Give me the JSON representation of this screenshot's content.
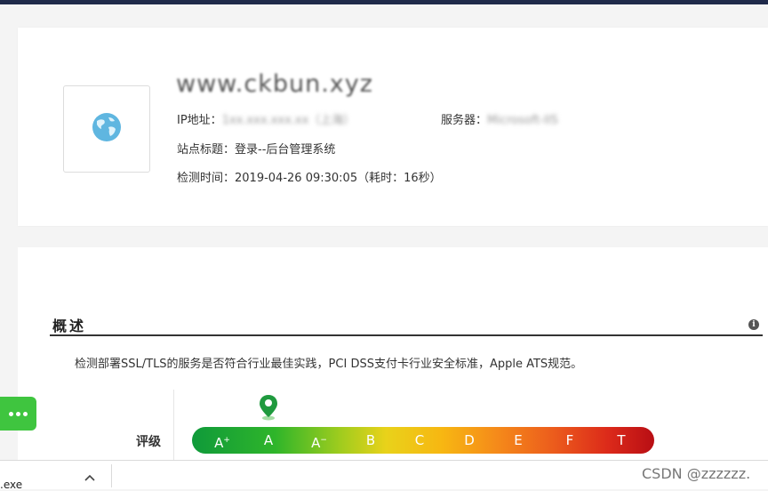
{
  "site": {
    "title": "www.ckbun.xyz",
    "ip_label": "IP地址：",
    "ip_value": "1xx.xxx.xxx.xx（上海）",
    "server_label": "服务器：",
    "server_value": "Microsoft-IIS",
    "page_title_label": "站点标题：",
    "page_title_value": "登录--后台管理系统",
    "check_time_label": "检测时间：",
    "check_time_value": "2019-04-26 09:30:05（耗时：16秒）"
  },
  "overview": {
    "title": "概述",
    "info_icon": "i",
    "description": "检测部署SSL/TLS的服务是否符合行业最佳实践，PCI DSS支付卡行业安全标准，Apple ATS规范。",
    "rating_label": "评级",
    "selected_grade": "A",
    "grades": [
      "A+",
      "A",
      "A-",
      "B",
      "C",
      "D",
      "E",
      "F",
      "T"
    ]
  },
  "download_bar": {
    "file_name": ".exe",
    "chevron": "^"
  },
  "watermark": "CSDN @zzzzzz."
}
